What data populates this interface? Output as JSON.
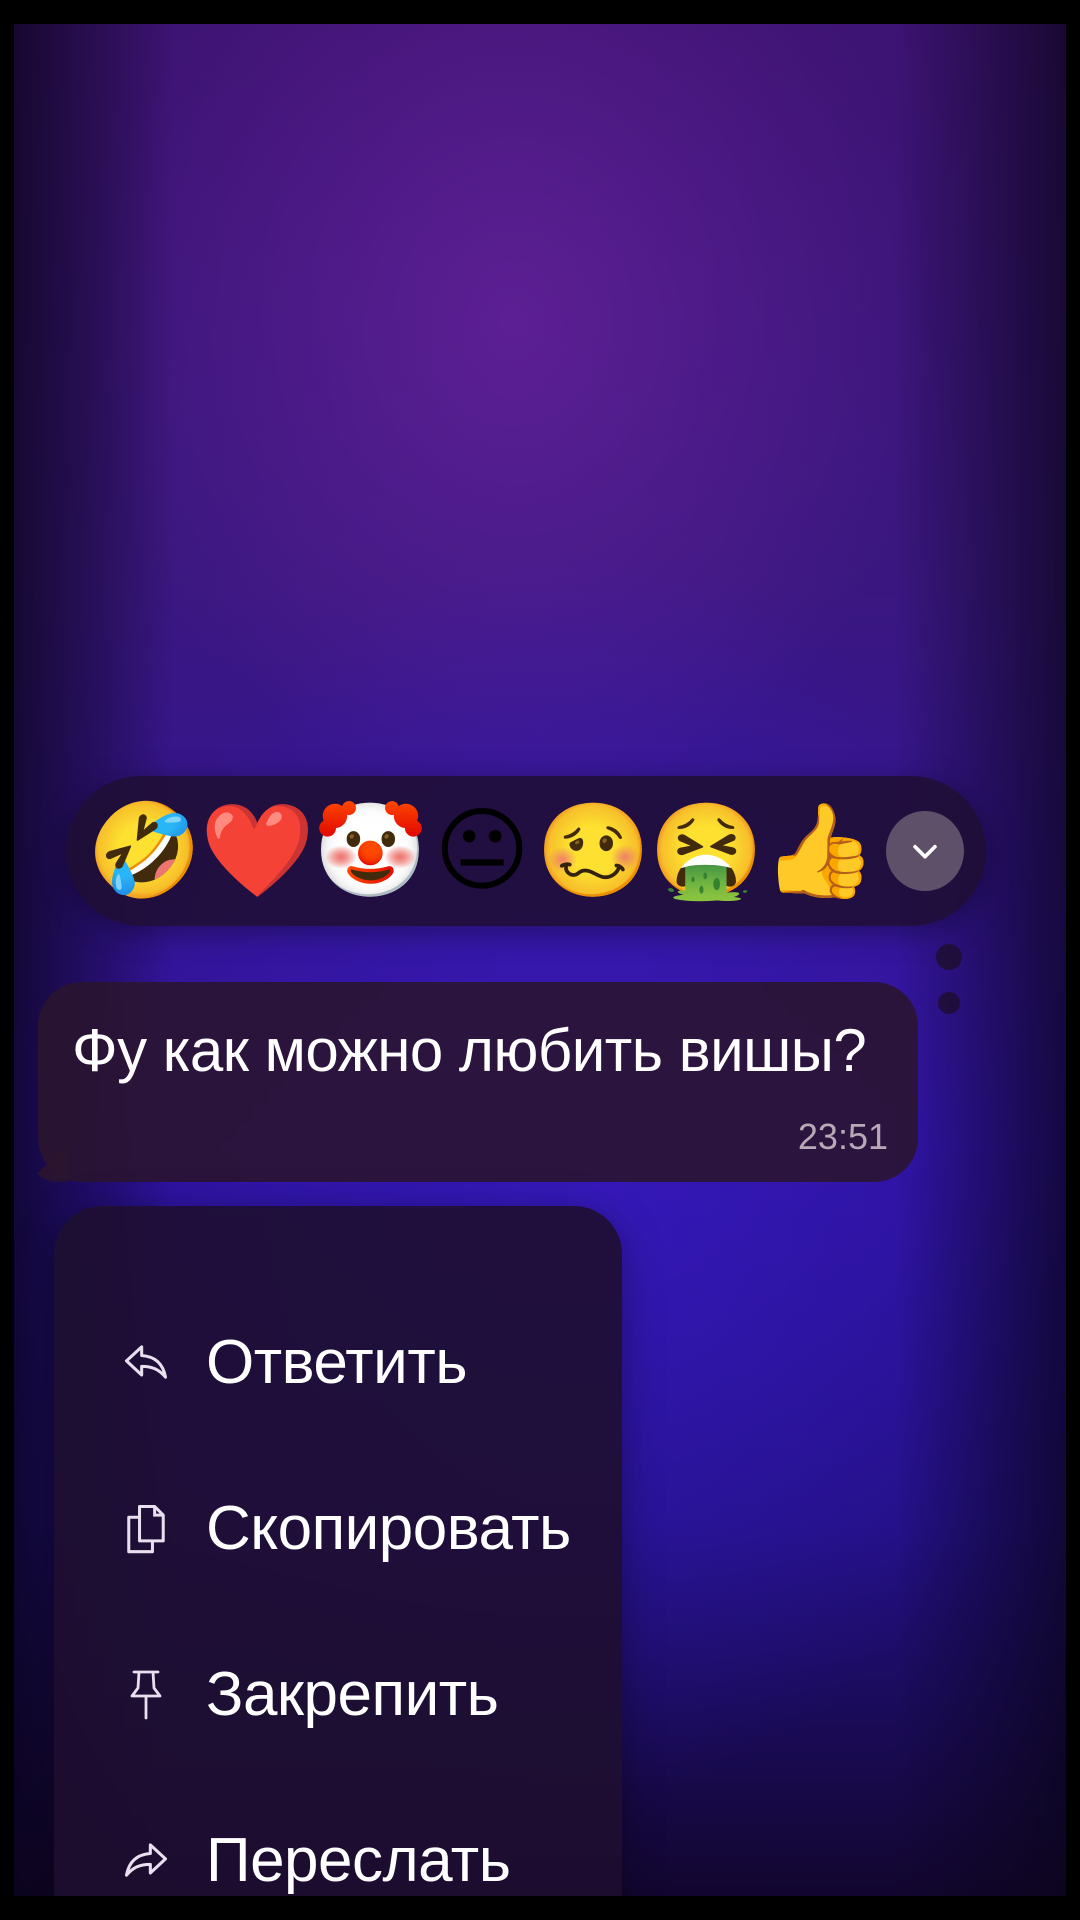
{
  "reactions": [
    {
      "emoji": "🤣",
      "icon": "rolling-on-floor-laughing"
    },
    {
      "emoji": "❤️",
      "icon": "red-heart"
    },
    {
      "emoji": "🤡",
      "icon": "clown-face"
    },
    {
      "emoji": "😐",
      "icon": "neutral-face"
    },
    {
      "emoji": "🥴",
      "icon": "woozy-face"
    },
    {
      "emoji": "🤮",
      "icon": "vomiting-face"
    },
    {
      "emoji": "👍",
      "icon": "thumbs-up"
    }
  ],
  "message": {
    "text": "Фу как можно любить вишы?",
    "time": "23:51"
  },
  "menu": {
    "items": [
      {
        "label": "Ответить",
        "icon": "reply-icon"
      },
      {
        "label": "Скопировать",
        "icon": "copy-icon"
      },
      {
        "label": "Закрепить",
        "icon": "pin-icon"
      },
      {
        "label": "Переслать",
        "icon": "forward-icon"
      }
    ]
  },
  "colors": {
    "menu_bg": "#1e0e30",
    "bubble_bg": "#2a142d",
    "more_button": "#5d5068",
    "time_text": "#b8a9b7"
  }
}
